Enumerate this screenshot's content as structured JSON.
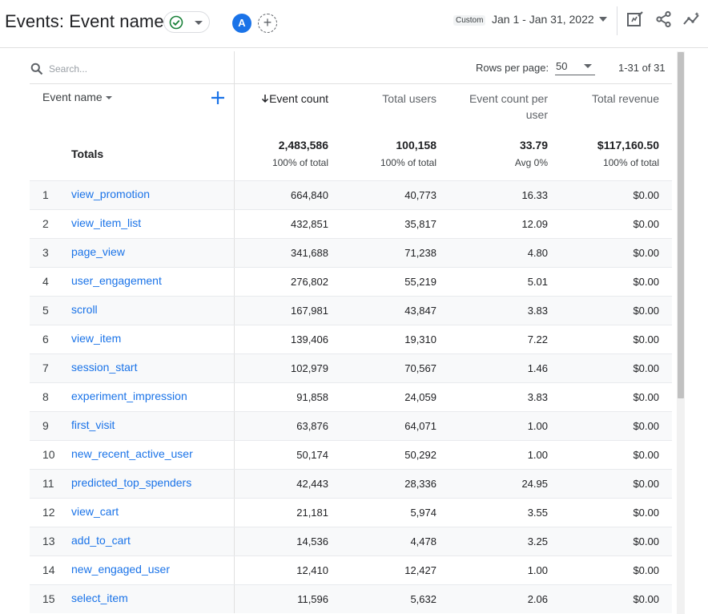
{
  "header": {
    "title": "Events: Event name",
    "avatar_letter": "A",
    "date_badge": "Custom",
    "date_range": "Jan 1 - Jan 31, 2022",
    "icons": [
      "check-circle-icon",
      "chevron-down-icon",
      "add-comparison-icon",
      "edit-report-icon",
      "share-icon",
      "insights-icon"
    ]
  },
  "colors": {
    "accent": "#1a73e8",
    "status_green": "#188038"
  },
  "table": {
    "search_placeholder": "Search...",
    "rows_per_page_label": "Rows per page:",
    "rows_per_page_value": "50",
    "pagination": "1-31 of 31",
    "dimension_header": "Event name",
    "columns": [
      "Event count",
      "Total users",
      "Event count per user",
      "Total revenue"
    ],
    "sort_icon": "arrow-down-icon",
    "totals_label": "Totals",
    "totals": [
      {
        "value": "2,483,586",
        "sub": "100% of total"
      },
      {
        "value": "100,158",
        "sub": "100% of total"
      },
      {
        "value": "33.79",
        "sub": "Avg 0%"
      },
      {
        "value": "$117,160.50",
        "sub": "100% of total"
      }
    ],
    "rows": [
      {
        "idx": "1",
        "name": "view_promotion",
        "event_count": "664,840",
        "total_users": "40,773",
        "per_user": "16.33",
        "revenue": "$0.00"
      },
      {
        "idx": "2",
        "name": "view_item_list",
        "event_count": "432,851",
        "total_users": "35,817",
        "per_user": "12.09",
        "revenue": "$0.00"
      },
      {
        "idx": "3",
        "name": "page_view",
        "event_count": "341,688",
        "total_users": "71,238",
        "per_user": "4.80",
        "revenue": "$0.00"
      },
      {
        "idx": "4",
        "name": "user_engagement",
        "event_count": "276,802",
        "total_users": "55,219",
        "per_user": "5.01",
        "revenue": "$0.00"
      },
      {
        "idx": "5",
        "name": "scroll",
        "event_count": "167,981",
        "total_users": "43,847",
        "per_user": "3.83",
        "revenue": "$0.00"
      },
      {
        "idx": "6",
        "name": "view_item",
        "event_count": "139,406",
        "total_users": "19,310",
        "per_user": "7.22",
        "revenue": "$0.00"
      },
      {
        "idx": "7",
        "name": "session_start",
        "event_count": "102,979",
        "total_users": "70,567",
        "per_user": "1.46",
        "revenue": "$0.00"
      },
      {
        "idx": "8",
        "name": "experiment_impression",
        "event_count": "91,858",
        "total_users": "24,059",
        "per_user": "3.83",
        "revenue": "$0.00"
      },
      {
        "idx": "9",
        "name": "first_visit",
        "event_count": "63,876",
        "total_users": "64,071",
        "per_user": "1.00",
        "revenue": "$0.00"
      },
      {
        "idx": "10",
        "name": "new_recent_active_user",
        "event_count": "50,174",
        "total_users": "50,292",
        "per_user": "1.00",
        "revenue": "$0.00"
      },
      {
        "idx": "11",
        "name": "predicted_top_spenders",
        "event_count": "42,443",
        "total_users": "28,336",
        "per_user": "24.95",
        "revenue": "$0.00"
      },
      {
        "idx": "12",
        "name": "view_cart",
        "event_count": "21,181",
        "total_users": "5,974",
        "per_user": "3.55",
        "revenue": "$0.00"
      },
      {
        "idx": "13",
        "name": "add_to_cart",
        "event_count": "14,536",
        "total_users": "4,478",
        "per_user": "3.25",
        "revenue": "$0.00"
      },
      {
        "idx": "14",
        "name": "new_engaged_user",
        "event_count": "12,410",
        "total_users": "12,427",
        "per_user": "1.00",
        "revenue": "$0.00"
      },
      {
        "idx": "15",
        "name": "select_item",
        "event_count": "11,596",
        "total_users": "5,632",
        "per_user": "2.06",
        "revenue": "$0.00"
      }
    ]
  }
}
